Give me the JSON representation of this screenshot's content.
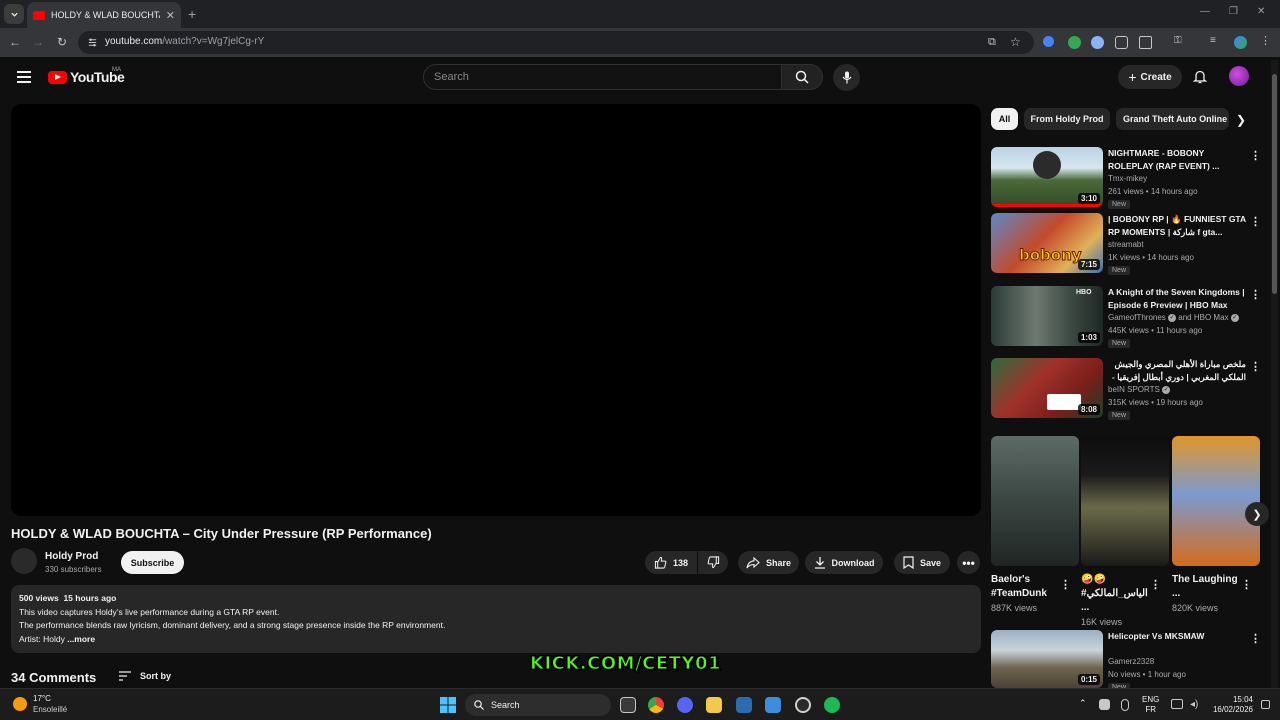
{
  "browser": {
    "tab_title": "HOLDY & WLAD BOUCHTA – City Under Pressure (RP Performance) - YouTube",
    "url_domain": "youtube.com",
    "url_path": "/watch?v=Wg7jelCg-rY"
  },
  "header": {
    "logo_text": "YouTube",
    "country_code": "MA",
    "search_placeholder": "Search",
    "create_label": "Create"
  },
  "video": {
    "title": "HOLDY & WLAD BOUCHTA – City Under Pressure (RP Performance)",
    "channel": "Holdy Prod",
    "subscribers": "330 subscribers",
    "subscribe_label": "Subscribe",
    "likes": "138",
    "share_label": "Share",
    "download_label": "Download",
    "save_label": "Save",
    "views": "500 views",
    "age": "15 hours ago",
    "desc_line1": "This video captures Holdy’s live performance during a GTA RP event.",
    "desc_line2": "The performance blends raw lyricism, dominant delivery, and a strong stage presence inside the RP environment.",
    "desc_line3": "Artist: Holdy",
    "more_label": "...more",
    "comments_count": "34 Comments",
    "sort_label": "Sort by"
  },
  "overlay_text": "KICK.COM/CETY01",
  "chips": [
    "All",
    "From Holdy Prod",
    "Grand Theft Auto Online"
  ],
  "recommendations": [
    {
      "title": "NIGHTMARE - BOBONY ROLEPLAY (RAP EVENT) ...",
      "channel": "Tmx-mikey",
      "meta": "261 views • 14 hours ago",
      "badge": "New",
      "duration": "3:10"
    },
    {
      "title": "| BOBONY RP | 🔥 FUNNIEST GTA RP MOMENTS | شاركة f gta...",
      "channel": "streamabt",
      "meta": "1K views • 14 hours ago",
      "badge": "New",
      "duration": "7:15"
    },
    {
      "title": "A Knight of the Seven Kingdoms | Episode 6 Preview | HBO Max",
      "channel": "GameofThrones",
      "channel2": "and HBO Max",
      "meta": "445K views • 11 hours ago",
      "badge": "New",
      "duration": "1:03"
    },
    {
      "title": "ملخص مباراة الأهلي المصري والجيش الملكي المغربي | دوري أبطال إفريقيا - الجولة",
      "channel": "beIN SPORTS",
      "meta": "315K views • 19 hours ago",
      "badge": "New",
      "duration": "8:08"
    }
  ],
  "shorts": [
    {
      "title": "Baelor's #TeamDunk",
      "views": "887K views"
    },
    {
      "title": "🤪🤪 #الياس_المالكي ...",
      "views": "16K views"
    },
    {
      "title": "The Laughing ...",
      "views": "820K views"
    }
  ],
  "recommendation_5": {
    "title": "Helicopter Vs MKSMAW",
    "channel": "Gamerz2328",
    "meta": "No views • 1 hour ago",
    "badge": "New",
    "duration": "0:15"
  },
  "taskbar": {
    "temperature": "17°C",
    "weather": "Ensoleillé",
    "search_label": "Search",
    "lang1": "ENG",
    "lang2": "FR",
    "time": "15:04",
    "date": "16/02/2026"
  },
  "colors": {
    "accent": "#ff0000",
    "kick_green": "#53fc18",
    "background": "#0f0f0f"
  }
}
